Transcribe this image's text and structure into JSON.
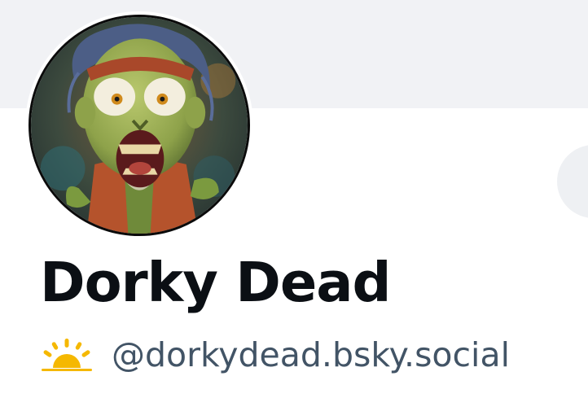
{
  "profile": {
    "display_name": "Dorky Dead",
    "handle": "@dorkydead.bsky.social",
    "status_icon": "sunrise-emoji-icon",
    "avatar_icon": "zombie-avatar"
  },
  "colors": {
    "banner": "#f1f2f5",
    "name_text": "#0b0f14",
    "handle_text": "#425466",
    "sun": "#f5b800"
  }
}
